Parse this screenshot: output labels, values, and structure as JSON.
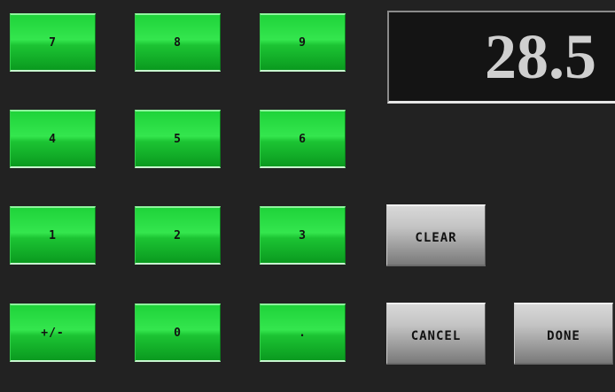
{
  "display": {
    "value": "28.5"
  },
  "keypad": {
    "row1": [
      "7",
      "8",
      "9"
    ],
    "row2": [
      "4",
      "5",
      "6"
    ],
    "row3": [
      "1",
      "2",
      "3"
    ],
    "row4": [
      "+/-",
      "0",
      "."
    ]
  },
  "actions": {
    "clear": "CLEAR",
    "cancel": "CANCEL",
    "done": "DONE"
  },
  "colors": {
    "background": "#222222",
    "key_green": "#1fd33a",
    "key_gray": "#b0b0b0",
    "display_text": "#d0d0d0"
  }
}
